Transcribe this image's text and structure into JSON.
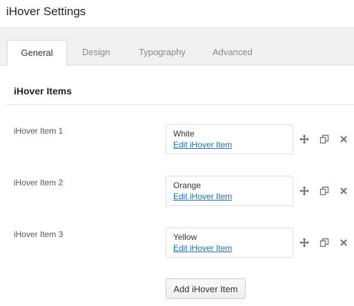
{
  "header": {
    "title": "iHover Settings"
  },
  "tabs": [
    {
      "label": "General",
      "active": true
    },
    {
      "label": "Design",
      "active": false
    },
    {
      "label": "Typography",
      "active": false
    },
    {
      "label": "Advanced",
      "active": false
    }
  ],
  "section": {
    "title": "iHover Items"
  },
  "items": [
    {
      "label": "iHover Item 1",
      "value": "White",
      "link": "Edit iHover Item"
    },
    {
      "label": "iHover Item 2",
      "value": "Orange",
      "link": "Edit iHover Item"
    },
    {
      "label": "iHover Item 3",
      "value": "Yellow",
      "link": "Edit iHover Item"
    }
  ],
  "controls": {
    "move_icon": "move-icon",
    "clone_icon": "clone-icon",
    "delete_icon": "delete-icon"
  },
  "add_button": {
    "label": "Add iHover Item"
  },
  "colors": {
    "link": "#1e6fa8",
    "tabbar_bg": "#f1f1f1",
    "border": "#dcdcdc"
  }
}
